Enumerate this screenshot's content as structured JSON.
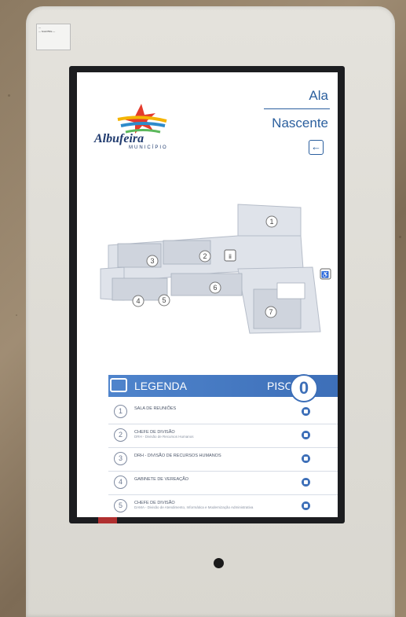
{
  "sticker": {
    "line1": "—",
    "line2": "— Smil P50s —"
  },
  "branding": {
    "name": "Albufeira",
    "sub": "MUNICÍPIO"
  },
  "wing": {
    "line1": "Ala",
    "line2": "Nascente"
  },
  "back_icon": "arrow-left-icon",
  "map": {
    "rooms": [
      "1",
      "2",
      "3",
      "4",
      "5",
      "6",
      "7"
    ],
    "wc_icon": "restroom-icon",
    "accessible_icon": "wheelchair-icon"
  },
  "legend": {
    "title": "LEGENDA",
    "floor_label": "PISO",
    "floor_value": "0",
    "items": [
      {
        "num": "1",
        "title": "SALA DE REUNIÕES",
        "sub": ""
      },
      {
        "num": "2",
        "title": "CHEFE DE DIVISÃO",
        "sub": "DRH - Divisão de Recursos Humanos"
      },
      {
        "num": "3",
        "title": "DRH - DIVISÃO DE RECURSOS HUMANOS",
        "sub": ""
      },
      {
        "num": "4",
        "title": "GABINETE DE VEREAÇÃO",
        "sub": ""
      },
      {
        "num": "5",
        "title": "CHEFE DE DIVISÃO",
        "sub": "DAMA - Divisão de Atendimento, Informática e Modernização Administrativa"
      }
    ]
  }
}
